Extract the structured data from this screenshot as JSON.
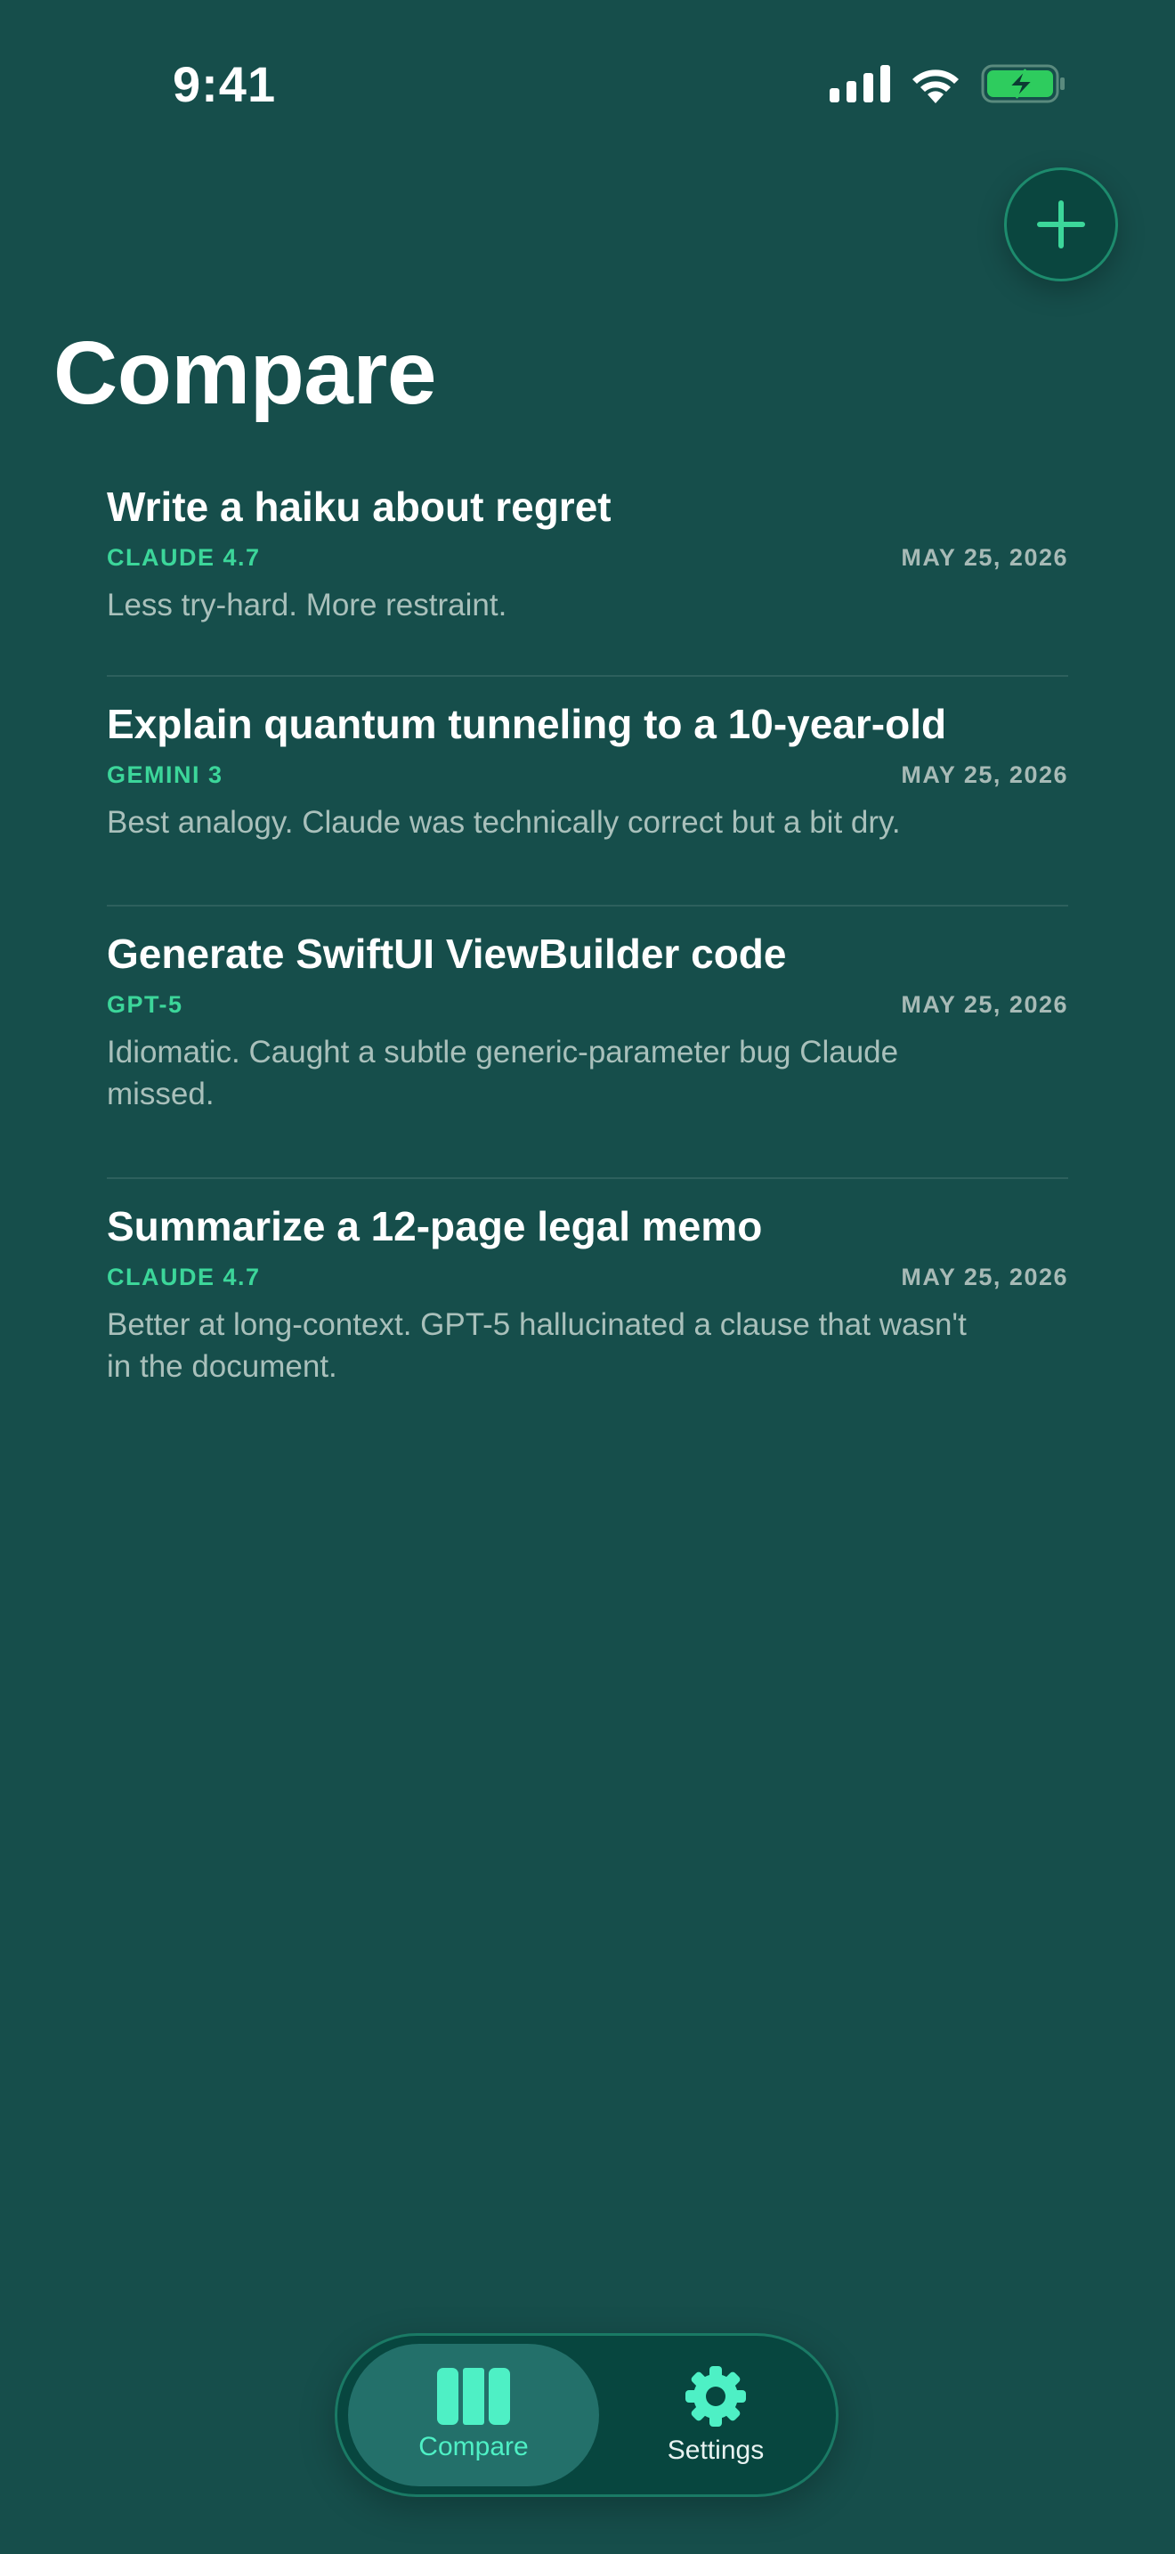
{
  "status_bar": {
    "time": "9:41"
  },
  "header": {
    "title": "Compare",
    "add_button_icon": "plus-icon"
  },
  "comparisons": [
    {
      "title": "Write a haiku about regret",
      "model": "CLAUDE 4.7",
      "date": "MAY 25, 2026",
      "note": "Less try-hard. More restraint."
    },
    {
      "title": "Explain quantum tunneling to a 10-year-old",
      "model": "GEMINI 3",
      "date": "MAY 25, 2026",
      "note": "Best analogy. Claude was technically correct but a bit dry."
    },
    {
      "title": "Generate SwiftUI ViewBuilder code",
      "model": "GPT-5",
      "date": "MAY 25, 2026",
      "note": "Idiomatic. Caught a subtle generic-parameter bug Claude missed."
    },
    {
      "title": "Summarize a 12-page legal memo",
      "model": "CLAUDE 4.7",
      "date": "MAY 25, 2026",
      "note": "Better at long-context. GPT-5 hallucinated a clause that wasn't in the document."
    }
  ],
  "tab_bar": {
    "tabs": [
      {
        "label": "Compare",
        "icon": "columns-icon",
        "selected": true
      },
      {
        "label": "Settings",
        "icon": "gear-icon",
        "selected": false
      }
    ]
  },
  "colors": {
    "background": "#164e4b",
    "accent": "#3cd69a",
    "tab_selected": "#4ef0c5",
    "battery": "#2ecc5e"
  }
}
